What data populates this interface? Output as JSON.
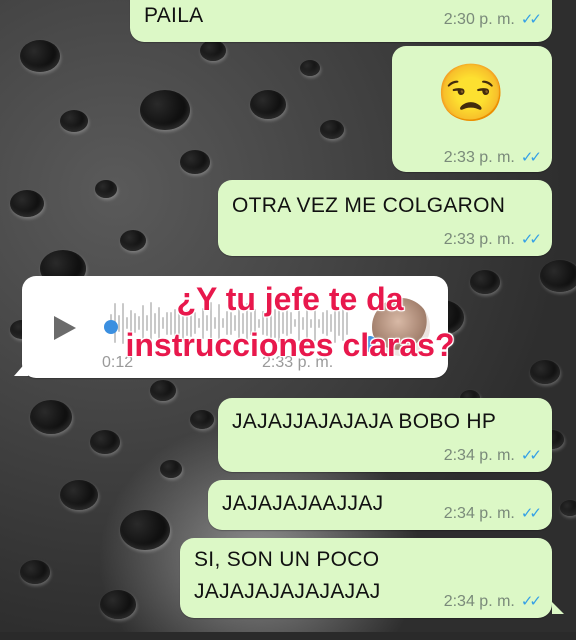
{
  "messages": [
    {
      "text": "PAILA",
      "time": "2:30 p. m."
    },
    {
      "emoji": "😒",
      "time": "2:33 p. m."
    },
    {
      "text": "OTRA VEZ ME COLGARON",
      "time": "2:33 p. m."
    },
    {
      "text": "JAJAJJAJAJAJA BOBO HP",
      "time": "2:34 p. m."
    },
    {
      "text": "JAJAJAJAAJJAJ",
      "time": "2:34 p. m."
    },
    {
      "text_line1": "SI, SON UN POCO",
      "text_line2": "JAJAJAJAJAJAJAJ",
      "time": "2:34 p. m."
    }
  ],
  "voice_note": {
    "duration": "0:12",
    "time": "2:33 p. m.",
    "play_icon": "play-icon",
    "avatar_icon": "avatar"
  },
  "overlay": {
    "line1": "¿Y tu jefe te da",
    "line2": "instrucciones claras?",
    "color": "#e8184c"
  },
  "ticks_glyph": "✓✓",
  "colors": {
    "outgoing_bubble": "#dcf8c6",
    "incoming_bubble": "#ffffff",
    "read_ticks": "#34a0e6"
  }
}
